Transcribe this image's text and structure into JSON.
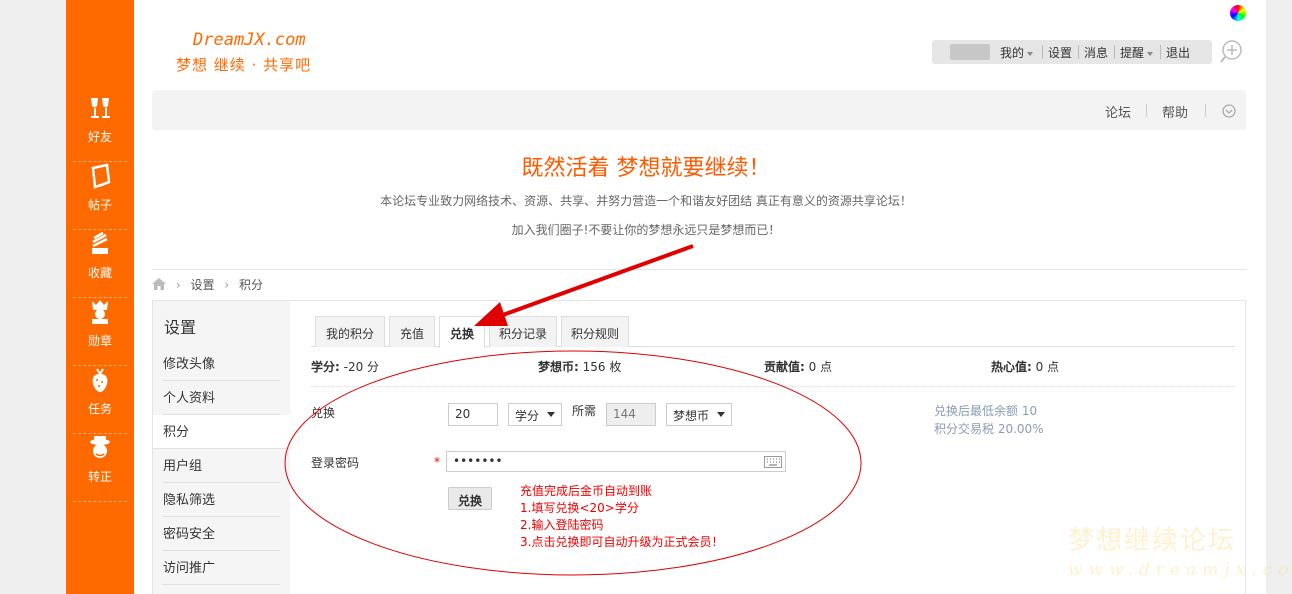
{
  "logo": {
    "en": "DreamJX.com",
    "cn": "梦想 继续 · 共享吧"
  },
  "sidebar": {
    "items": [
      {
        "label": "好友",
        "icon": "friends-icon"
      },
      {
        "label": "帖子",
        "icon": "posts-icon"
      },
      {
        "label": "收藏",
        "icon": "favorites-icon"
      },
      {
        "label": "勋章",
        "icon": "medal-icon"
      },
      {
        "label": "任务",
        "icon": "tasks-icon"
      },
      {
        "label": "转正",
        "icon": "upgrade-icon"
      }
    ]
  },
  "userbar": {
    "my": "我的",
    "settings": "设置",
    "messages": "消息",
    "reminders": "提醒",
    "logout": "退出"
  },
  "navstrip": {
    "forum": "论坛",
    "help": "帮助"
  },
  "banner": {
    "slogan": "既然活着 梦想就要继续！",
    "line1": "本论坛专业致力网络技术、资源、共享、并努力营造一个和谐友好团结 真正有意义的资源共享论坛！",
    "line2": "加入我们圈子!不要让你的梦想永远只是梦想而已！"
  },
  "breadcrumb": {
    "settings": "设置",
    "points": "积分"
  },
  "settings_menu": {
    "title": "设置",
    "items": [
      "修改头像",
      "个人资料",
      "积分",
      "用户组",
      "隐私筛选",
      "密码安全",
      "访问推广"
    ],
    "active_index": 2
  },
  "tabs": [
    "我的积分",
    "充值",
    "兑换",
    "积分记录",
    "积分规则"
  ],
  "active_tab": "兑换",
  "stats": [
    {
      "label": "学分:",
      "value": "-20 分"
    },
    {
      "label": "梦想币:",
      "value": "156 枚"
    },
    {
      "label": "贡献值:",
      "value": "0 点"
    },
    {
      "label": "热心值:",
      "value": "0 点"
    }
  ],
  "exchange": {
    "label": "兑换",
    "amount": "20",
    "from_unit": "学分",
    "required_label": "所需",
    "required_value": "144",
    "to_unit": "梦想币",
    "hint1": "兑换后最低余额 10",
    "hint2": "积分交易税 20.00%"
  },
  "password": {
    "label": "登录密码",
    "required_mark": "*",
    "value": "•••••••"
  },
  "submit": {
    "label": "兑换"
  },
  "notes": [
    "充值完成后金币自动到账",
    "1.填写兑换<20>学分",
    "2.输入登陆密码",
    "3.点击兑换即可自动升级为正式会员！"
  ],
  "watermark": {
    "cn": "梦想继续论坛",
    "en": "www.dreamjx.com"
  },
  "colors": {
    "brand": "#ff6a00",
    "annotation": "#e00000"
  }
}
